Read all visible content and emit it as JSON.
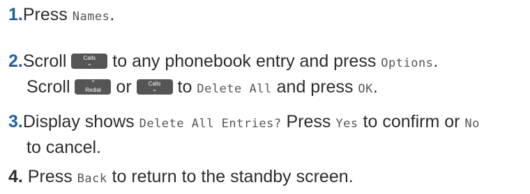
{
  "steps": [
    {
      "number": "1.",
      "text_a": "Press ",
      "display_a": "Names",
      "text_b": "."
    },
    {
      "number": "2.",
      "text_a": "Scroll ",
      "text_b": " to any phonebook entry and press ",
      "display_a": "Options",
      "text_c": ".",
      "text_d": "Scroll ",
      "text_e": " or ",
      "text_f": " to ",
      "display_b": "Delete All",
      "text_g": " and press ",
      "display_c": "OK",
      "text_h": "."
    },
    {
      "number": "3.",
      "text_a": "Display shows ",
      "display_a": "Delete All Entries?",
      "text_b": " Press ",
      "display_b": "Yes",
      "text_c": " to confirm or ",
      "display_c": "No",
      "text_d": "to cancel."
    },
    {
      "number": "4.",
      "text_a": " Press ",
      "display_a": "Back",
      "text_b": " to return to the standby screen."
    }
  ],
  "keys": {
    "calls": {
      "label": "Calls",
      "icon": "chevron-down-icon",
      "glyph": "⌄"
    },
    "redial": {
      "label": "Redial",
      "icon": "chevron-up-icon",
      "glyph": "⌃"
    }
  },
  "colors": {
    "step_number": "#1d5fa0",
    "body_text": "#2c2c2c",
    "display_text": "#555555",
    "key_background": "#555555"
  }
}
